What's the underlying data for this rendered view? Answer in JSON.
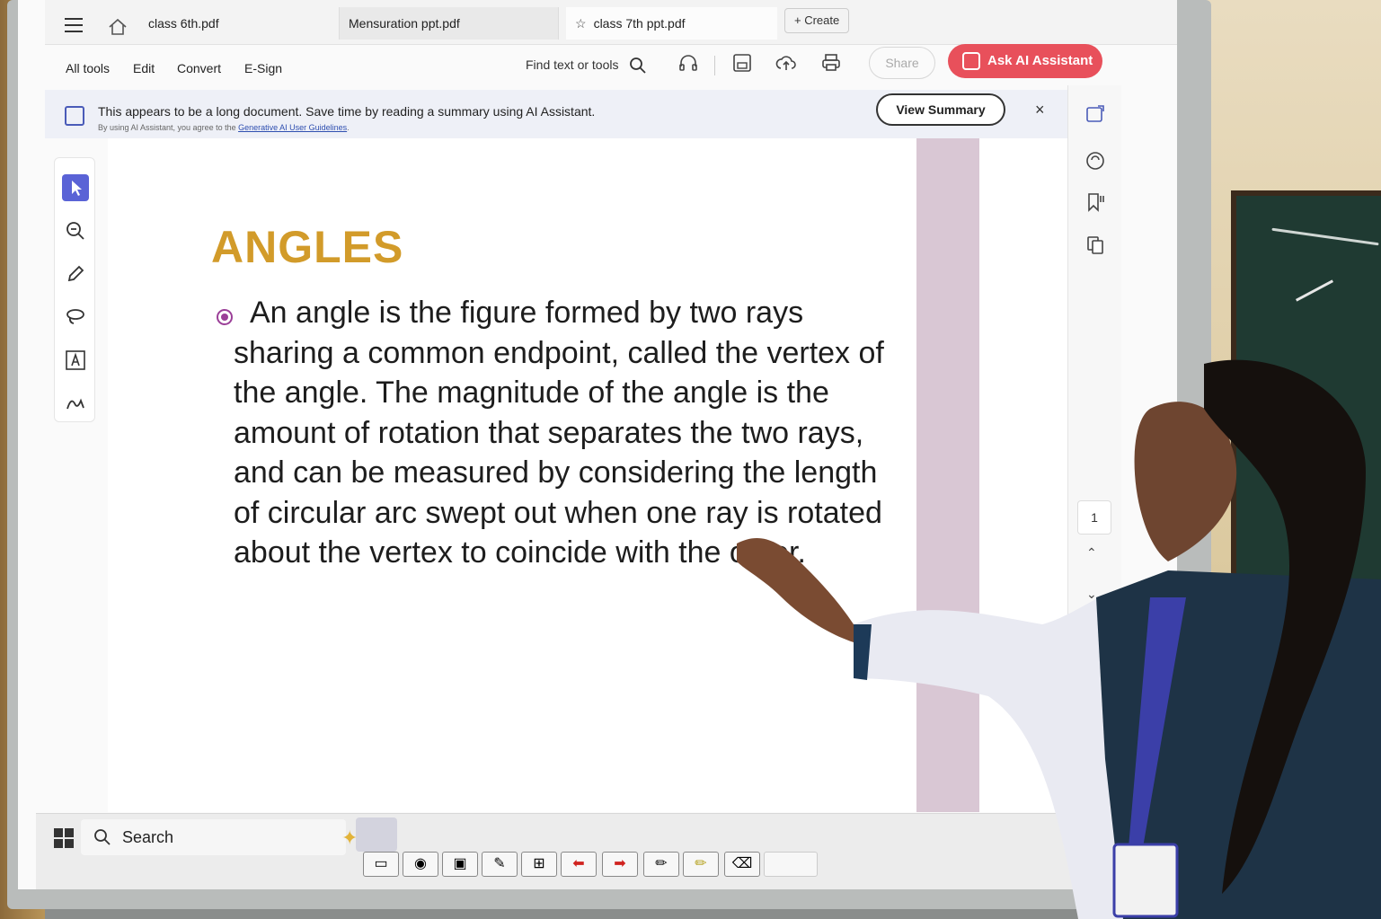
{
  "tabs": [
    {
      "label": "class 6th.pdf"
    },
    {
      "label": "Mensuration ppt.pdf"
    },
    {
      "label": "class 7th ppt.pdf"
    }
  ],
  "create_label": "Create",
  "menu": {
    "all_tools": "All tools",
    "edit": "Edit",
    "convert": "Convert",
    "esign": "E-Sign"
  },
  "find_label": "Find text or tools",
  "share_label": "Share",
  "ai_assistant_label": "Ask AI Assistant",
  "banner": {
    "text": "This appears to be a long document. Save time by reading a summary using AI Assistant.",
    "sub_prefix": "By using AI Assistant, you agree to the ",
    "sub_link": "Generative AI User Guidelines",
    "sub_suffix": ".",
    "view_summary": "View Summary",
    "close": "×"
  },
  "slide": {
    "title": "ANGLES",
    "body": "An angle is the figure formed by two rays sharing a common endpoint, called the vertex of the angle. The magnitude of the angle is the amount of rotation that separates the two rays, and can be measured by considering the length of circular arc swept out when one ray is rotated about the vertex to coincide with the other."
  },
  "page_number": "1",
  "taskbar": {
    "search_placeholder": "Search"
  },
  "colors": {
    "title": "#d29b2a",
    "bullet": "#9b3f98",
    "ai_button": "#e8505b",
    "select_tool": "#5a63d6",
    "side_band": "#d9c7d4"
  }
}
